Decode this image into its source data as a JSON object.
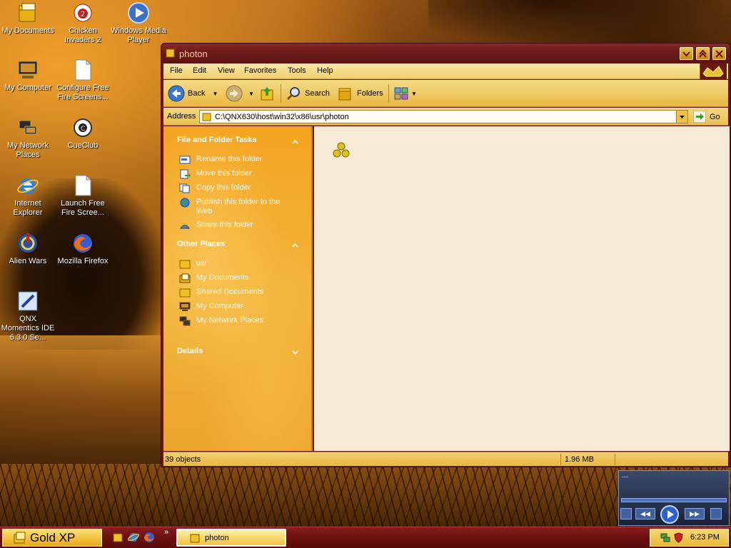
{
  "desktop": {
    "icons": [
      {
        "label": "My Documents",
        "icon": "my-documents-icon"
      },
      {
        "label": "Chicken Invaders 2",
        "icon": "chicken-invaders-icon"
      },
      {
        "label": "Windows Media Player",
        "icon": "windows-media-player-icon"
      },
      {
        "label": "My Computer",
        "icon": "my-computer-icon"
      },
      {
        "label": "Configure Free Fire Screens...",
        "icon": "document-icon"
      },
      {
        "label": "My Network Places",
        "icon": "network-places-icon"
      },
      {
        "label": "CueClub",
        "icon": "cueclub-icon"
      },
      {
        "label": "Internet Explorer",
        "icon": "internet-explorer-icon"
      },
      {
        "label": "Launch Free Fire Scree...",
        "icon": "document-icon"
      },
      {
        "label": "Alien Wars",
        "icon": "alien-wars-icon"
      },
      {
        "label": "Mozilla Firefox",
        "icon": "firefox-icon"
      },
      {
        "label": "QNX Momentics IDE 6.3.0 Se...",
        "icon": "qnx-momentics-icon"
      }
    ]
  },
  "window": {
    "title": "photon",
    "menu": [
      "File",
      "Edit",
      "View",
      "Favorites",
      "Tools",
      "Help"
    ],
    "toolbar": {
      "back_label": "Back",
      "search_label": "Search",
      "folders_label": "Folders"
    },
    "address": {
      "label": "Address",
      "value": "C:\\QNX630\\host\\win32\\x86\\usr\\photon",
      "go_label": "Go"
    },
    "sidebar": {
      "file_tasks": {
        "title": "File and Folder Tasks",
        "items": [
          {
            "label": "Rename this folder",
            "icon": "rename-icon"
          },
          {
            "label": "Move this folder",
            "icon": "move-icon"
          },
          {
            "label": "Copy this folder",
            "icon": "copy-icon"
          },
          {
            "label": "Publish this folder to the Web",
            "icon": "globe-icon"
          },
          {
            "label": "Share this folder",
            "icon": "share-icon"
          }
        ]
      },
      "other_places": {
        "title": "Other Places",
        "items": [
          {
            "label": "usr",
            "icon": "folder-icon"
          },
          {
            "label": "My Documents",
            "icon": "my-documents-icon"
          },
          {
            "label": "Shared Documents",
            "icon": "folder-icon"
          },
          {
            "label": "My Computer",
            "icon": "my-computer-icon"
          },
          {
            "label": "My Network Places",
            "icon": "network-places-icon"
          }
        ]
      },
      "details": {
        "title": "Details"
      }
    },
    "status": {
      "objects": "39 objects",
      "size": "1.96 MB"
    }
  },
  "taskbar": {
    "start_label": "Gold XP",
    "chevron": "»",
    "active_task": "photon",
    "clock": "6:23 PM"
  },
  "wmp_mini": {
    "status_text": "---"
  },
  "colors": {
    "title_bar": "#6e1a1a",
    "sidebar": "#f2b43a",
    "content_bg": "#f6ead6",
    "taskbar": "#6a1010",
    "gold": "#f0c040"
  }
}
